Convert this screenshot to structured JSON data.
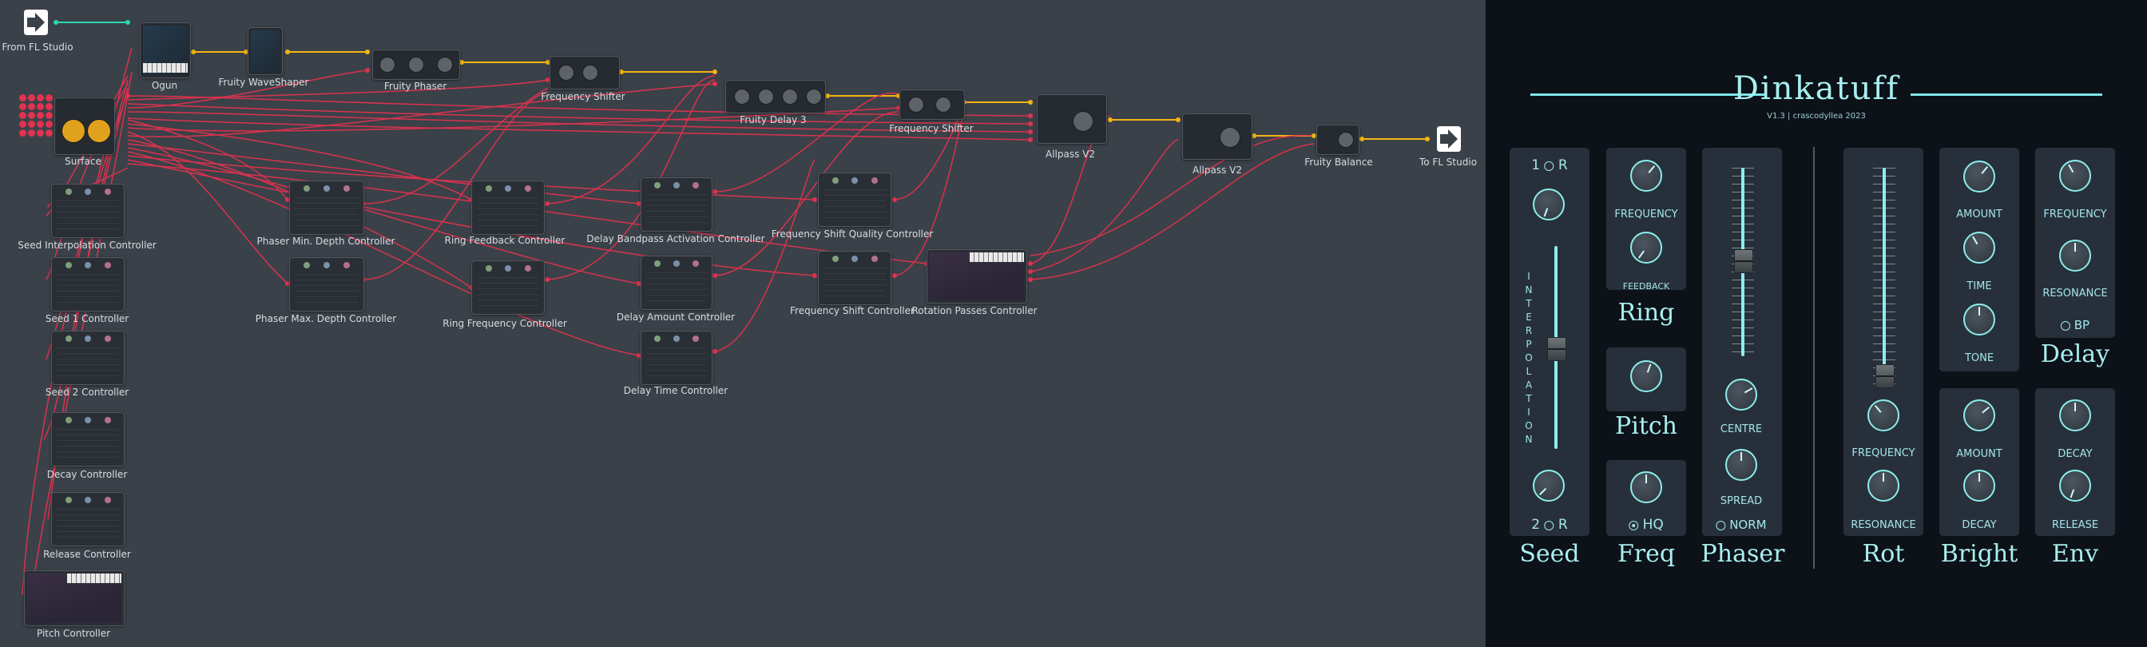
{
  "patcher": {
    "input_label": "From FL Studio",
    "output_label": "To FL Studio",
    "effects": [
      "Ogun",
      "Fruity WaveShaper",
      "Fruity Phaser",
      "Frequency Shifter",
      "Fruity Delay 3",
      "Frequency Shifter",
      "Allpass V2",
      "Allpass V2",
      "Fruity Balance"
    ],
    "surface_label": "Surface",
    "controllers": {
      "seed_interpolation": "Seed Interpolation Controller",
      "seed1": "Seed 1 Controller",
      "seed2": "Seed 2 Controller",
      "decay": "Decay Controller",
      "release": "Release Controller",
      "pitch": "Pitch Controller",
      "phaser_min_depth": "Phaser Min. Depth Controller",
      "phaser_max_depth": "Phaser Max. Depth Controller",
      "ring_feedback": "Ring Feedback Controller",
      "ring_frequency": "Ring Frequency Controller",
      "delay_bandpass": "Delay Bandpass Activation Controller",
      "delay_amount": "Delay Amount Controller",
      "delay_time": "Delay Time Controller",
      "freq_shift_quality": "Frequency Shift Quality Controller",
      "freq_shift": "Frequency Shift Controller",
      "rotation_passes": "Rotation Passes Controller"
    }
  },
  "panel": {
    "title": "Dinkatuff",
    "subtitle": "V1.3 | crascodyllea 2023",
    "seed": {
      "top_label": "1",
      "top_r": "R",
      "interp_letters": [
        "I",
        "N",
        "T",
        "E",
        "R",
        "P",
        "O",
        "L",
        "A",
        "T",
        "I",
        "O",
        "N"
      ],
      "bottom_label": "2",
      "bottom_r": "R",
      "section": "Seed"
    },
    "ring": {
      "frequency": "FREQUENCY",
      "feedback": "FEEDBACK",
      "section": "Ring"
    },
    "pitch": {
      "section": "Pitch"
    },
    "freq": {
      "hq": "HQ",
      "section": "Freq"
    },
    "phaser": {
      "centre": "CENTRE",
      "spread": "SPREAD",
      "norm": "NORM",
      "section": "Phaser"
    },
    "rot": {
      "frequency": "FREQUENCY",
      "resonance": "RESONANCE",
      "section": "Rot"
    },
    "bright": {
      "amount_top": "AMOUNT",
      "time": "TIME",
      "tone": "TONE",
      "amount_bottom": "AMOUNT",
      "decay": "DECAY",
      "section": "Bright"
    },
    "delay": {
      "frequency": "FREQUENCY",
      "resonance": "RESONANCE",
      "bp": "BP",
      "section": "Delay"
    },
    "env": {
      "decay": "DECAY",
      "release": "RELEASE",
      "section": "Env"
    }
  },
  "colors": {
    "patcher_bg": "#3b4148",
    "wire_audio": "#f5b415",
    "wire_control": "#e1324f",
    "wire_input": "#2bd6b0",
    "panel_bg": "#0c1218",
    "panel_accent": "#8ceeee"
  }
}
